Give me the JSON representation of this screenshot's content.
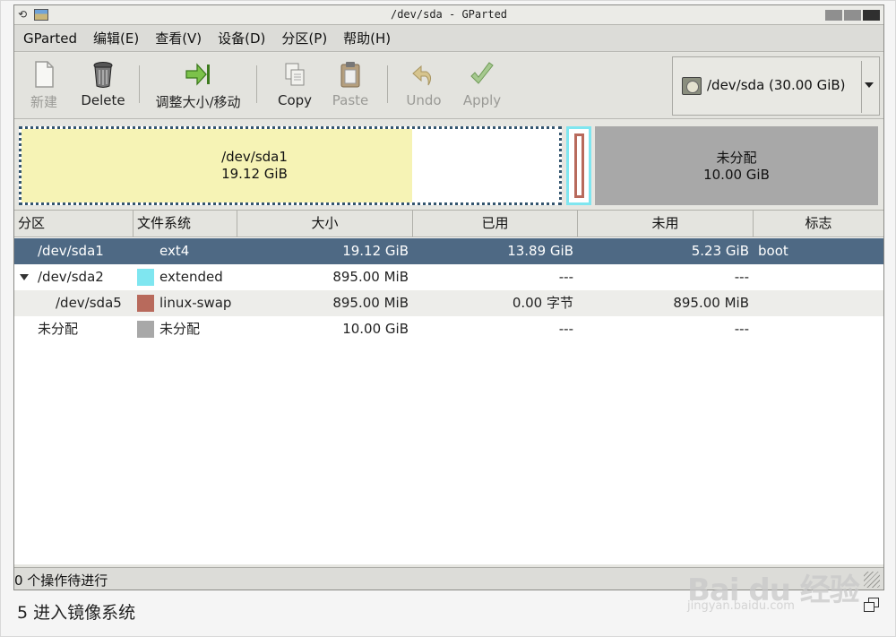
{
  "window": {
    "title": "/dev/sda - GParted"
  },
  "menu": [
    "GParted",
    "编辑(E)",
    "查看(V)",
    "设备(D)",
    "分区(P)",
    "帮助(H)"
  ],
  "toolbar": {
    "new": "新建",
    "delete": "Delete",
    "resize": "调整大小/移动",
    "copy": "Copy",
    "paste": "Paste",
    "undo": "Undo",
    "apply": "Apply"
  },
  "device": {
    "label": "/dev/sda  (30.00 GiB)"
  },
  "graph": {
    "sda1": {
      "name": "/dev/sda1",
      "size": "19.12 GiB",
      "used_fraction": 0.727,
      "fill_color": "#f6f3b5"
    },
    "unalloc": {
      "name": "未分配",
      "size": "10.00 GiB",
      "color": "#a8a8a8"
    },
    "extended_color": "#7fe6f0",
    "swap_color": "#b86a5c"
  },
  "table": {
    "headers": [
      "分区",
      "文件系统",
      "大小",
      "已用",
      "未用",
      "标志"
    ],
    "rows": [
      {
        "partition": "/dev/sda1",
        "fs": "ext4",
        "size": "19.12 GiB",
        "used": "13.89 GiB",
        "unused": "5.23 GiB",
        "flags": "boot",
        "swatch": "#f6f3b5"
      },
      {
        "partition": "/dev/sda2",
        "fs": "extended",
        "size": "895.00 MiB",
        "used": "---",
        "unused": "---",
        "flags": "",
        "swatch": "#7fe6f0"
      },
      {
        "partition": "/dev/sda5",
        "fs": "linux-swap",
        "size": "895.00 MiB",
        "used": "0.00 字节",
        "unused": "895.00 MiB",
        "flags": "",
        "swatch": "#b86a5c"
      },
      {
        "partition": "未分配",
        "fs": "未分配",
        "size": "10.00 GiB",
        "used": "---",
        "unused": "---",
        "flags": "",
        "swatch": "#a8a8a8"
      }
    ]
  },
  "status": {
    "text": "0 个操作待进行"
  },
  "caption": "5 进入镜像系统",
  "watermark": {
    "brand": "Bai du 经验",
    "url": "jingyan.baidu.com"
  }
}
